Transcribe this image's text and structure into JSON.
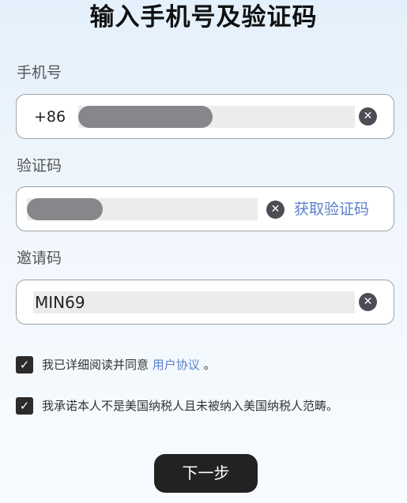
{
  "page": {
    "title": "输入手机号及验证码"
  },
  "phone": {
    "label": "手机号",
    "prefix": "+86",
    "value_hidden": true
  },
  "verification": {
    "label": "验证码",
    "value_hidden": true,
    "get_code_label": "获取验证码"
  },
  "invite": {
    "label": "邀请码",
    "value": "MIN69"
  },
  "agreements": {
    "user_agreement_prefix": "我已详细阅读并同意",
    "user_agreement_link": "用户协议",
    "user_agreement_suffix": "。",
    "user_agreement_checked": true,
    "us_statement": "我承诺本人不是美国纳税人且未被纳入美国纳税人范畴。",
    "us_statement_checked": true
  },
  "actions": {
    "next_label": "下一步"
  },
  "icons": {
    "clear": "clear-icon",
    "check": "checkmark-icon"
  },
  "colors": {
    "accent_link": "#5b7fc9",
    "button_bg": "#222222",
    "mask": "#86878a"
  }
}
